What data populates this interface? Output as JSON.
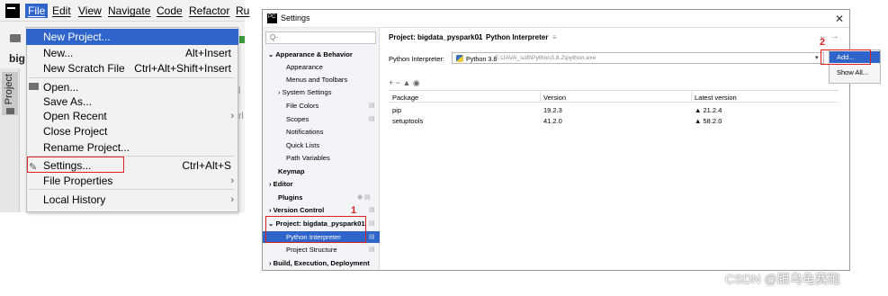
{
  "ide": {
    "logo_text": "PC",
    "menubar": [
      {
        "label": "File",
        "active": true
      },
      {
        "label": "Edit"
      },
      {
        "label": "View"
      },
      {
        "label": "Navigate"
      },
      {
        "label": "Code"
      },
      {
        "label": "Refactor"
      },
      {
        "label": "Ru"
      }
    ],
    "project_label": "big",
    "side_tab": "Project",
    "right_clip_1": "l",
    "right_clip_2": "rl"
  },
  "file_menu": {
    "items": [
      {
        "label": "New Project...",
        "shortcut": "",
        "arrow": false,
        "selected": true
      },
      {
        "label": "New...",
        "shortcut": "Alt+Insert",
        "arrow": false
      },
      {
        "label": "New Scratch File",
        "shortcut": "Ctrl+Alt+Shift+Insert",
        "arrow": false
      },
      {
        "label": "Open...",
        "shortcut": "",
        "arrow": false,
        "icon": "folder-icon"
      },
      {
        "label": "Save As...",
        "shortcut": "",
        "arrow": false
      },
      {
        "label": "Open Recent",
        "shortcut": "",
        "arrow": true
      },
      {
        "label": "Close Project",
        "shortcut": "",
        "arrow": false
      },
      {
        "label": "Rename Project...",
        "shortcut": "",
        "arrow": false
      },
      {
        "label": "Settings...",
        "shortcut": "Ctrl+Alt+S",
        "arrow": false,
        "icon": "wrench-icon"
      },
      {
        "label": "File Properties",
        "shortcut": "",
        "arrow": true
      },
      {
        "label": "Local History",
        "shortcut": "",
        "arrow": true
      }
    ]
  },
  "settings_dialog": {
    "title": "Settings",
    "search_placeholder": "Q-",
    "tree": [
      {
        "label": "Appearance & Behavior",
        "bold": true,
        "level": 0,
        "prefix": "⌄"
      },
      {
        "label": "Appearance",
        "level": 1
      },
      {
        "label": "Menus and Toolbars",
        "level": 1
      },
      {
        "label": "System Settings",
        "level": 1,
        "prefix": ">"
      },
      {
        "label": "File Colors",
        "level": 1,
        "icon": true
      },
      {
        "label": "Scopes",
        "level": 1,
        "icon": true
      },
      {
        "label": "Notifications",
        "level": 1
      },
      {
        "label": "Quick Lists",
        "level": 1
      },
      {
        "label": "Path Variables",
        "level": 1
      },
      {
        "label": "Keymap",
        "bold": true,
        "level": 0
      },
      {
        "label": "Editor",
        "bold": true,
        "level": 0,
        "prefix": ">"
      },
      {
        "label": "Plugins",
        "bold": true,
        "level": 0,
        "icon": true
      },
      {
        "label": "Version Control",
        "bold": true,
        "level": 0,
        "prefix": ">",
        "icon": true
      },
      {
        "label": "Project: bigdata_pyspark01",
        "bold": true,
        "level": 0,
        "prefix": "⌄",
        "icon": true
      },
      {
        "label": "Python Interpreter",
        "level": 1,
        "selected": true,
        "icon": true
      },
      {
        "label": "Project Structure",
        "level": 1,
        "icon": true
      },
      {
        "label": "Build, Execution, Deployment",
        "bold": true,
        "level": 0,
        "prefix": ">"
      }
    ],
    "breadcrumb": {
      "project": "Project: bigdata_pyspark01",
      "separator": "›",
      "page": "Python Interpreter",
      "menu_glyph": "≡"
    },
    "nav_arrows": "← →",
    "interpreter_label": "Python Interpreter:",
    "interpreter_name": "Python 3.8",
    "interpreter_path": "E:\\JAVA_soft\\Python3.8.2\\python.exe",
    "gear_menu": {
      "add": "Add...",
      "show_all": "Show All..."
    },
    "pkg_toolbar": "+  −  ▲  ◉",
    "table": {
      "columns": [
        "Package",
        "Version",
        "Latest version"
      ],
      "rows": [
        {
          "package": "pip",
          "version": "19.2.3",
          "latest": "▲ 21.2.4"
        },
        {
          "package": "setuptools",
          "version": "41.2.0",
          "latest": "▲ 58.2.0"
        }
      ]
    }
  },
  "annotations": {
    "step1": "1",
    "step2": "2"
  },
  "watermark": "CSDN @跟乌龟赛跑",
  "colors": {
    "selection": "#2f65ca",
    "highlight_box": "#e02020"
  }
}
